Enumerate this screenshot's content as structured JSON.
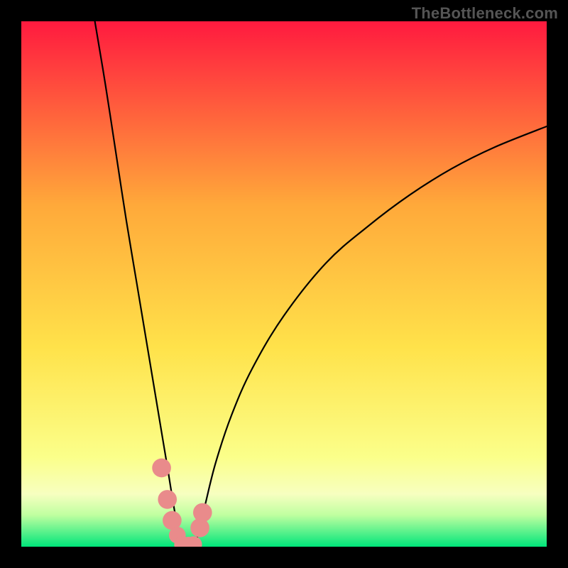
{
  "watermark": "TheBottleneck.com",
  "chart_data": {
    "type": "line",
    "title": "",
    "xlabel": "",
    "ylabel": "",
    "xlim": [
      0,
      100
    ],
    "ylim": [
      0,
      100
    ],
    "grid": false,
    "legend": false,
    "background_gradient": {
      "top": "#ff1a3f",
      "mid_upper": "#ffa93a",
      "mid": "#ffe24a",
      "mid_lower": "#fbff8a",
      "band": "#f7ffc0",
      "bottom": "#00e57a"
    },
    "series": [
      {
        "name": "left-branch",
        "x": [
          14.0,
          16.0,
          18.0,
          20.0,
          22.0,
          24.0,
          26.0,
          27.0,
          28.0,
          28.8,
          29.5,
          30.0,
          30.6
        ],
        "y": [
          100.0,
          88.0,
          75.0,
          62.0,
          50.0,
          38.0,
          26.0,
          20.0,
          14.0,
          9.0,
          5.0,
          2.5,
          0.0
        ]
      },
      {
        "name": "right-branch",
        "x": [
          33.0,
          33.8,
          35.0,
          37.0,
          40.0,
          44.0,
          50.0,
          58.0,
          66.0,
          74.0,
          82.0,
          90.0,
          100.0
        ],
        "y": [
          0.0,
          3.0,
          8.0,
          16.0,
          25.0,
          34.0,
          44.0,
          54.0,
          61.0,
          67.0,
          72.0,
          76.0,
          80.0
        ]
      },
      {
        "name": "floor",
        "x": [
          30.6,
          33.0
        ],
        "y": [
          0.0,
          0.0
        ]
      }
    ],
    "markers": [
      {
        "name": "left-dot-1",
        "x": 26.7,
        "y": 15.0,
        "r": 1.8
      },
      {
        "name": "left-dot-2",
        "x": 27.8,
        "y": 9.0,
        "r": 1.8
      },
      {
        "name": "left-dot-3",
        "x": 28.7,
        "y": 5.0,
        "r": 1.8
      },
      {
        "name": "left-dot-4",
        "x": 29.7,
        "y": 2.2,
        "r": 1.6
      },
      {
        "name": "notch-dot-1",
        "x": 30.7,
        "y": 0.4,
        "r": 1.6
      },
      {
        "name": "notch-dot-2",
        "x": 31.8,
        "y": 0.3,
        "r": 1.6
      },
      {
        "name": "notch-dot-3",
        "x": 32.8,
        "y": 0.4,
        "r": 1.6
      },
      {
        "name": "right-dot-1",
        "x": 34.0,
        "y": 3.6,
        "r": 1.8
      },
      {
        "name": "right-dot-2",
        "x": 34.5,
        "y": 6.5,
        "r": 1.8
      }
    ],
    "marker_color": "#e98b8b"
  }
}
